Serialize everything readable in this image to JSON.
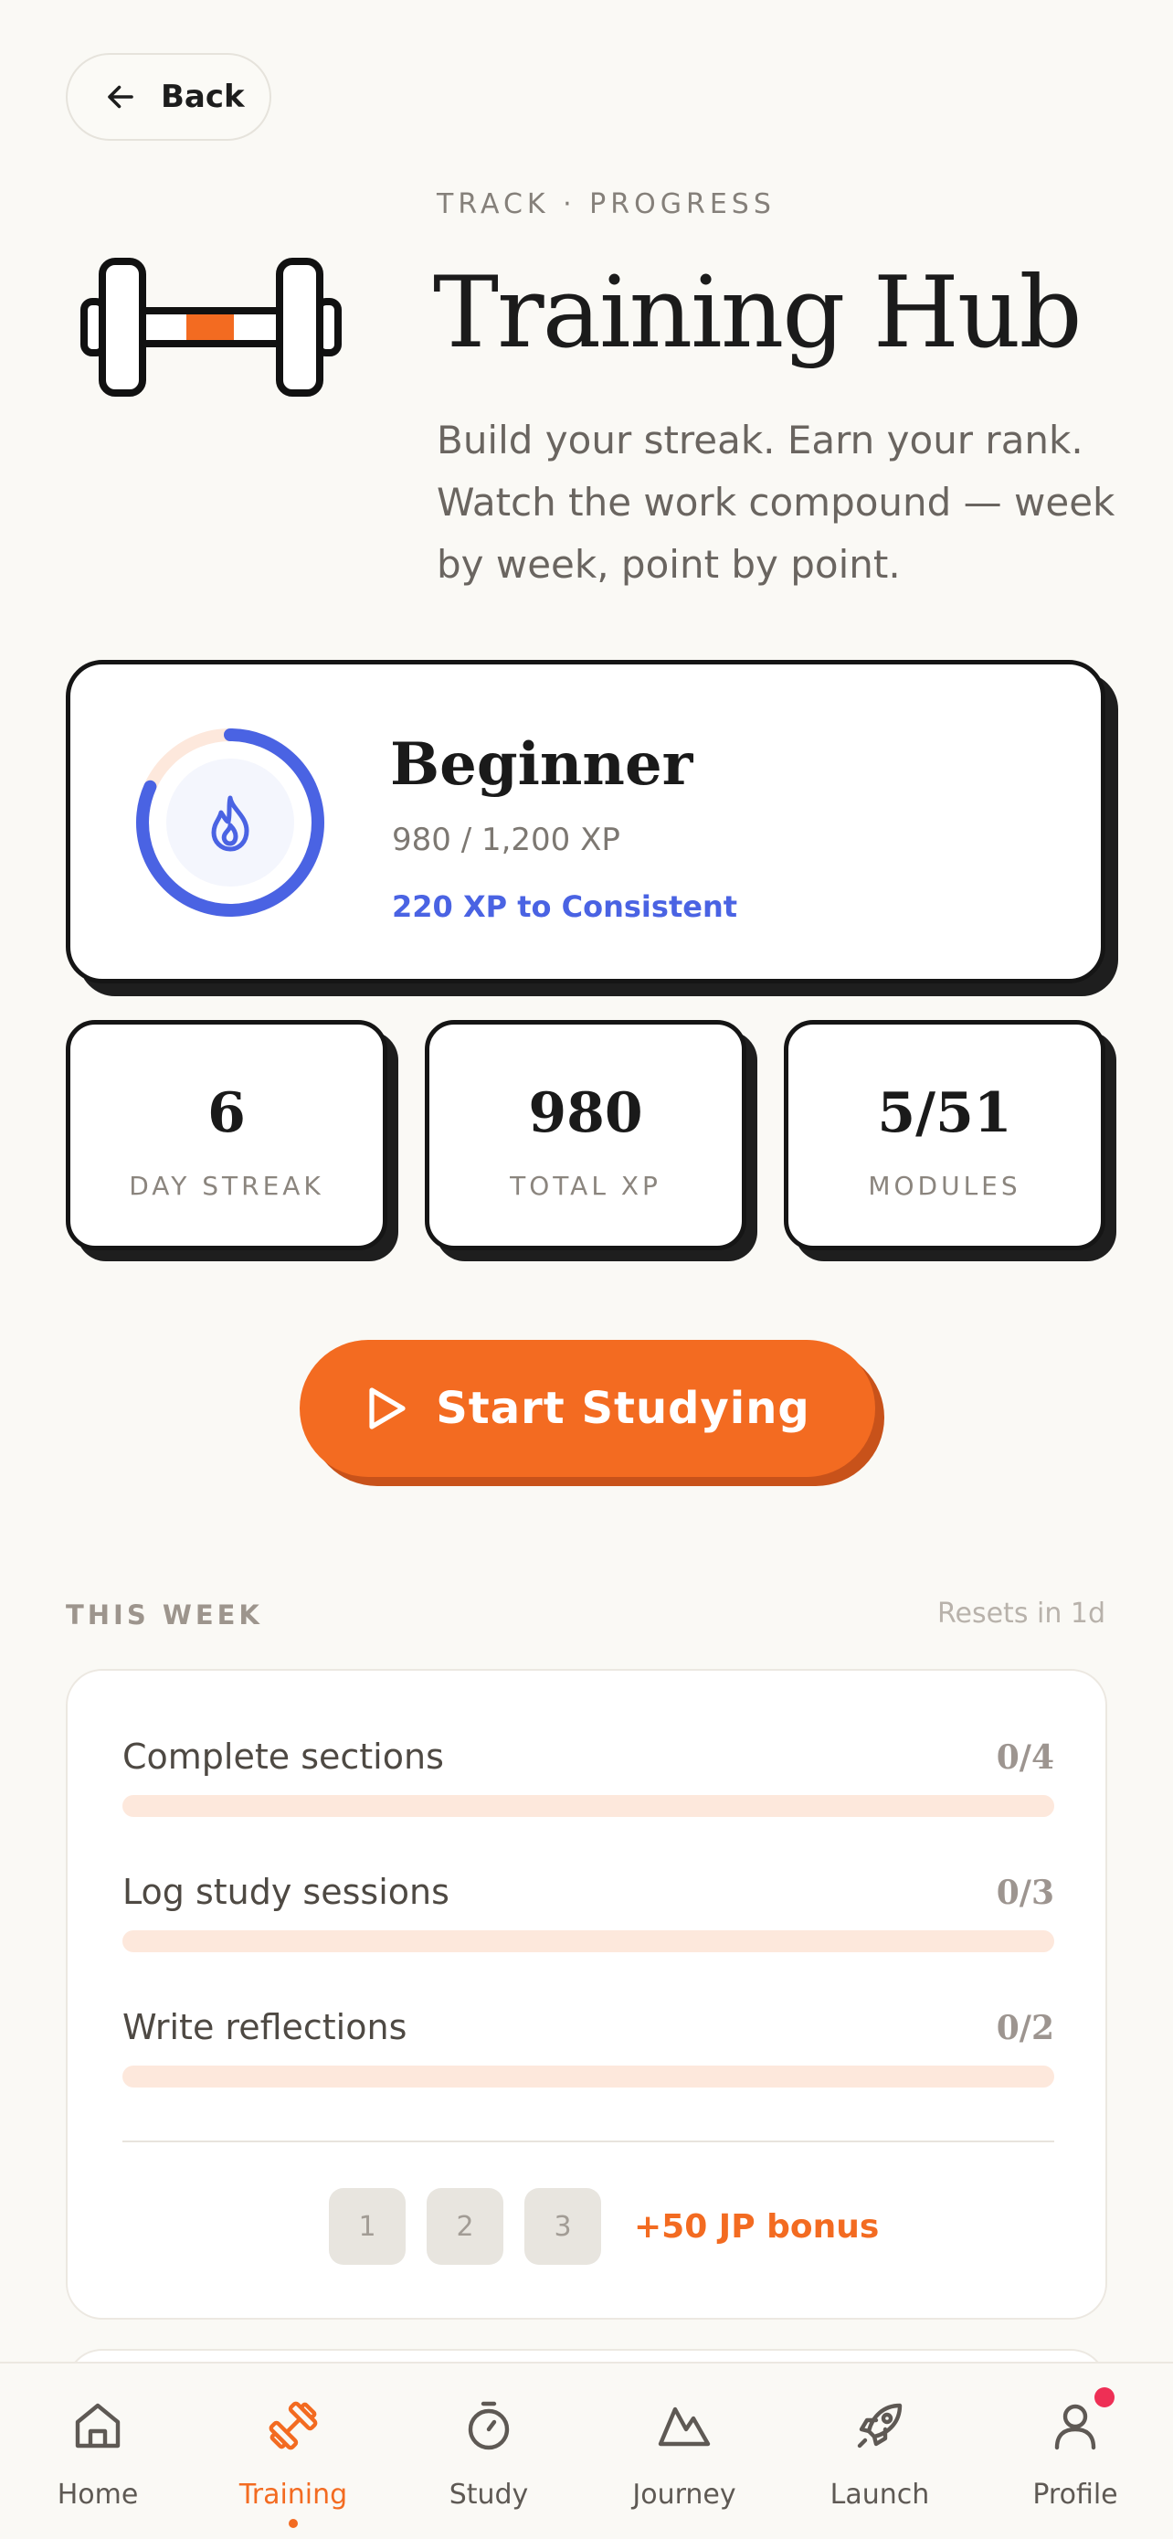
{
  "header": {
    "back_label": "Back",
    "eyebrow": "TRACK · PROGRESS",
    "title": "Training Hub",
    "subtitle_line1": "Build your streak. Earn your rank.",
    "subtitle_line2": "Watch the work compound — week",
    "subtitle_line3": "by week, point by point.",
    "icon": "dumbbell-icon"
  },
  "rank": {
    "name": "Beginner",
    "xp_text": "980 / 1,200 XP",
    "next_text": "220 XP to Consistent",
    "progress": 0.8167,
    "icon": "flame-icon",
    "ring_color": "#4a63e3",
    "ring_track_color": "#fde8dc"
  },
  "stats": [
    {
      "value": "6",
      "label": "DAY STREAK"
    },
    {
      "value": "980",
      "label": "TOTAL XP"
    },
    {
      "value": "5/51",
      "label": "MODULES"
    }
  ],
  "start": {
    "label": "Start Studying",
    "icon": "play-icon"
  },
  "week": {
    "heading": "THIS WEEK",
    "reset": "Resets in 1d",
    "tasks": [
      {
        "name": "Complete sections",
        "count": "0/4",
        "progress": 0
      },
      {
        "name": "Log study sessions",
        "count": "0/3",
        "progress": 0
      },
      {
        "name": "Write reflections",
        "count": "0/2",
        "progress": 0
      }
    ],
    "chips": [
      "1",
      "2",
      "3"
    ],
    "bonus": "+50 JP bonus"
  },
  "nav": {
    "items": [
      {
        "label": "Home",
        "icon": "home-icon"
      },
      {
        "label": "Training",
        "icon": "dumbbell-icon",
        "active": true
      },
      {
        "label": "Study",
        "icon": "stopwatch-icon"
      },
      {
        "label": "Journey",
        "icon": "mountain-icon"
      },
      {
        "label": "Launch",
        "icon": "rocket-icon"
      },
      {
        "label": "Profile",
        "icon": "user-icon",
        "notification": true
      }
    ]
  },
  "colors": {
    "accent": "#f36b21",
    "accent_shadow": "#c8521a",
    "rank_blue": "#4a63e3",
    "background": "#faf9f5",
    "notification": "#ee2f55"
  }
}
